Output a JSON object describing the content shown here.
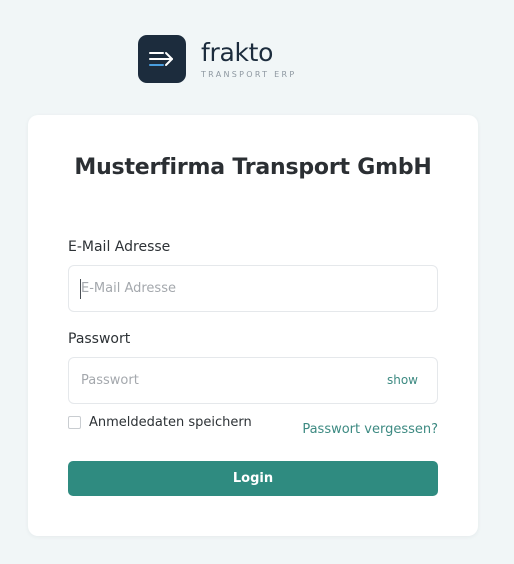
{
  "brand": {
    "name": "frakto",
    "subtitle": "TRANSPORT ERP",
    "logo_icon": "arrow-lines-icon",
    "logo_bg": "#1c2c3d",
    "accent": "#2f8b80"
  },
  "login": {
    "company": "Musterfirma Transport GmbH",
    "email_label": "E-Mail Adresse",
    "email_placeholder": "E-Mail Adresse",
    "email_value": "",
    "password_label": "Passwort",
    "password_placeholder": "Passwort",
    "password_value": "",
    "show_label": "show",
    "remember_label": "Anmeldedaten speichern",
    "remember_checked": false,
    "forgot_label": "Passwort vergessen?",
    "login_label": "Login"
  }
}
